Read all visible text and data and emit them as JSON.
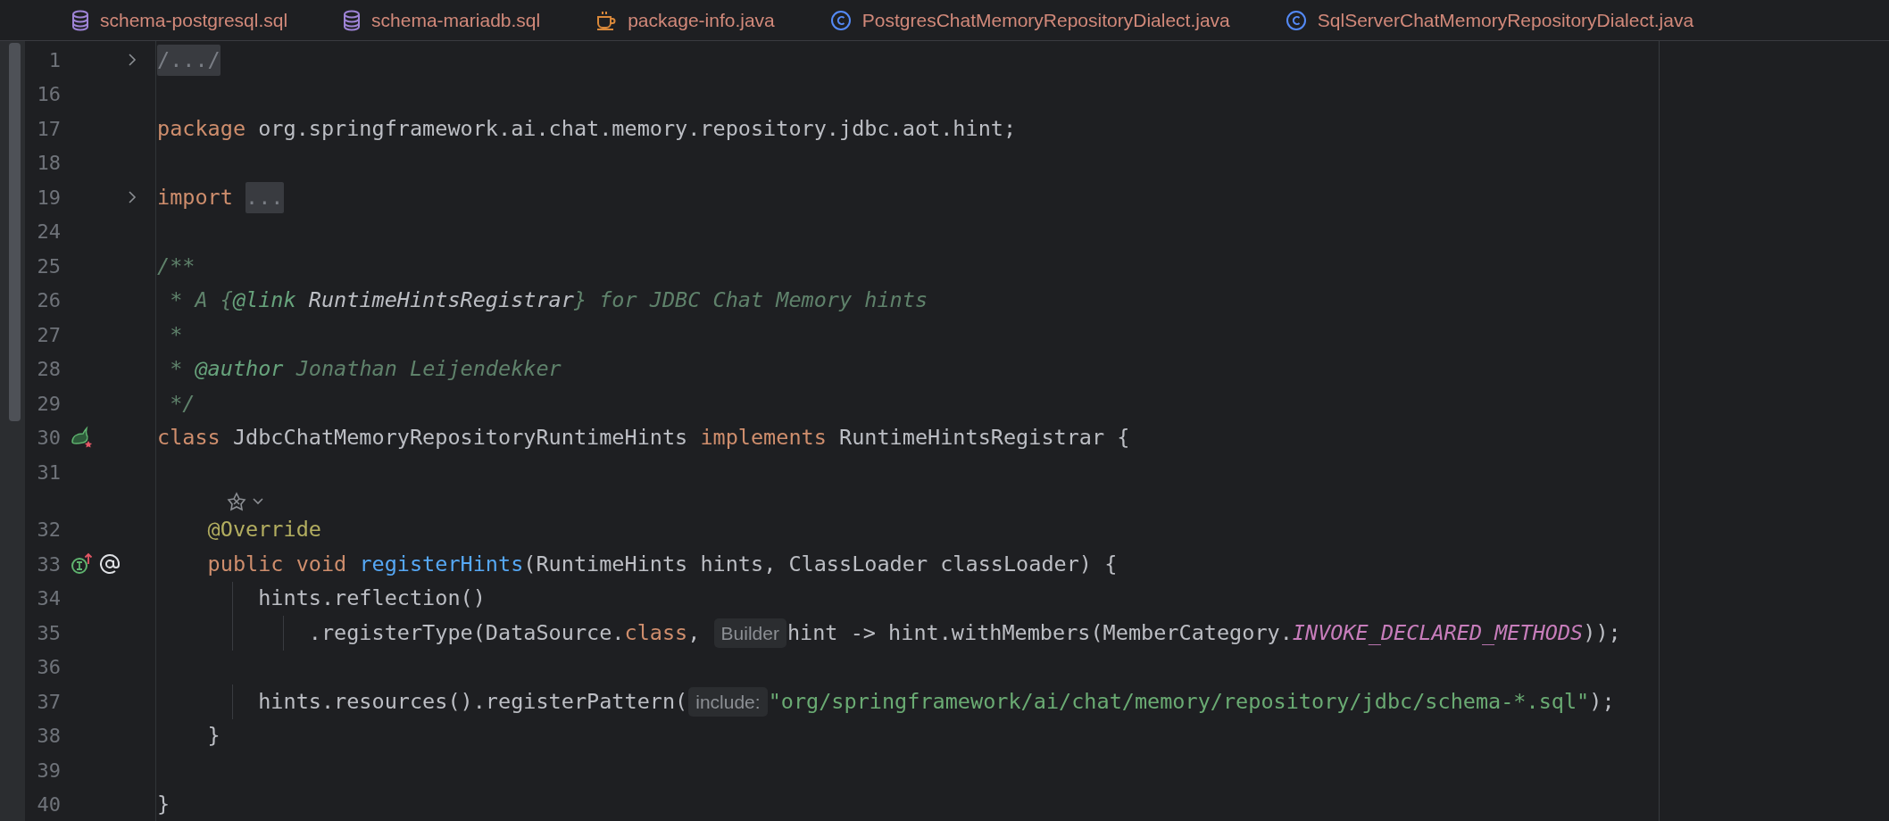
{
  "tabs": [
    {
      "label": "schema-postgresql.sql",
      "kind": "sql"
    },
    {
      "label": "schema-mariadb.sql",
      "kind": "sql"
    },
    {
      "label": "package-info.java",
      "kind": "package"
    },
    {
      "label": "PostgresChatMemoryRepositoryDialect.java",
      "kind": "class"
    },
    {
      "label": "SqlServerChatMemoryRepositoryDialect.java",
      "kind": "class"
    }
  ],
  "editor": {
    "lines": [
      {
        "kind": "code",
        "number": "1",
        "folded": true,
        "tokens": [
          {
            "kind": "fold",
            "text": "/.../"
          }
        ]
      },
      {
        "kind": "code",
        "number": "16",
        "folded": false
      },
      {
        "kind": "code",
        "number": "17",
        "folded": false,
        "tokens": [
          {
            "kind": "keyword",
            "text": "package "
          },
          {
            "kind": "plain",
            "text": "org.springframework.ai.chat.memory.repository.jdbc.aot.hint;"
          }
        ]
      },
      {
        "kind": "code",
        "number": "18",
        "folded": false
      },
      {
        "kind": "code",
        "number": "19",
        "folded": true,
        "tokens": [
          {
            "kind": "keyword",
            "text": "import "
          },
          {
            "kind": "fold",
            "text": "..."
          }
        ]
      },
      {
        "kind": "code",
        "number": "24",
        "folded": false
      },
      {
        "kind": "code",
        "number": "25",
        "folded": false,
        "tokens": [
          {
            "kind": "doc",
            "text": "/**"
          }
        ]
      },
      {
        "kind": "code",
        "number": "26",
        "folded": false,
        "tokens": [
          {
            "kind": "doc",
            "text": " * A {"
          },
          {
            "kind": "doctag",
            "text": "@link"
          },
          {
            "kind": "docref",
            "text": " RuntimeHintsRegistrar"
          },
          {
            "kind": "doc",
            "text": "} for JDBC Chat Memory hints"
          }
        ]
      },
      {
        "kind": "code",
        "number": "27",
        "folded": false,
        "tokens": [
          {
            "kind": "doc",
            "text": " *"
          }
        ]
      },
      {
        "kind": "code",
        "number": "28",
        "folded": false,
        "tokens": [
          {
            "kind": "doc",
            "text": " * "
          },
          {
            "kind": "doctag",
            "text": "@author"
          },
          {
            "kind": "doc",
            "text": " Jonathan Leijendekker"
          }
        ]
      },
      {
        "kind": "code",
        "number": "29",
        "folded": false,
        "tokens": [
          {
            "kind": "doc",
            "text": " */"
          }
        ]
      },
      {
        "kind": "code",
        "number": "30",
        "folded": false,
        "markers": [
          {
            "kind": "bean"
          }
        ],
        "tokens": [
          {
            "kind": "keyword",
            "text": "class "
          },
          {
            "kind": "plain",
            "text": "JdbcChatMemoryRepositoryRuntimeHints "
          },
          {
            "kind": "keyword",
            "text": "implements "
          },
          {
            "kind": "plain",
            "text": "RuntimeHintsRegistrar {"
          }
        ]
      },
      {
        "kind": "code",
        "number": "31",
        "folded": false
      },
      {
        "kind": "hint-row"
      },
      {
        "kind": "code",
        "number": "32",
        "folded": false,
        "tokens": [
          {
            "kind": "annotation",
            "text": "    @Override"
          }
        ]
      },
      {
        "kind": "code",
        "number": "33",
        "folded": false,
        "markers": [
          {
            "kind": "implements"
          },
          {
            "kind": "override"
          }
        ],
        "tokens": [
          {
            "kind": "keyword",
            "text": "    public void "
          },
          {
            "kind": "function",
            "text": "registerHints"
          },
          {
            "kind": "plain",
            "text": "(RuntimeHints hints, ClassLoader classLoader) {"
          }
        ]
      },
      {
        "kind": "code",
        "number": "34",
        "folded": false,
        "tokens": [
          {
            "kind": "plain",
            "text": "        hints.reflection()"
          }
        ]
      },
      {
        "kind": "code",
        "number": "35",
        "folded": false,
        "tokens": [
          {
            "kind": "plain",
            "text": "            .registerType(DataSource."
          },
          {
            "kind": "keyword",
            "text": "class"
          },
          {
            "kind": "plain",
            "text": ", "
          },
          {
            "kind": "hint",
            "text": "Builder"
          },
          {
            "kind": "plain",
            "text": "hint -> hint.withMembers(MemberCategory."
          },
          {
            "kind": "constant",
            "text": "INVOKE_DECLARED_METHODS"
          },
          {
            "kind": "plain",
            "text": "));"
          }
        ]
      },
      {
        "kind": "code",
        "number": "36",
        "folded": false
      },
      {
        "kind": "code",
        "number": "37",
        "folded": false,
        "tokens": [
          {
            "kind": "plain",
            "text": "        hints.resources().registerPattern("
          },
          {
            "kind": "hint",
            "text": "include:"
          },
          {
            "kind": "string",
            "text": "\"org/springframework/ai/chat/memory/repository/jdbc/schema-*.sql\""
          },
          {
            "kind": "plain",
            "text": ");"
          }
        ]
      },
      {
        "kind": "code",
        "number": "38",
        "folded": false,
        "tokens": [
          {
            "kind": "plain",
            "text": "    }"
          }
        ]
      },
      {
        "kind": "code",
        "number": "39",
        "folded": false
      },
      {
        "kind": "code",
        "number": "40",
        "folded": false,
        "tokens": [
          {
            "kind": "plain",
            "text": "}"
          }
        ]
      }
    ]
  }
}
